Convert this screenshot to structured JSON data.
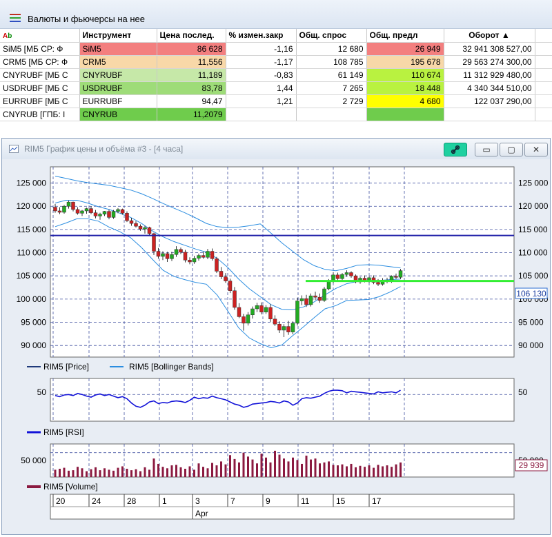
{
  "quotes_window": {
    "title": "Валюты и фьючерсы на нее",
    "ab_marker": {
      "a": "A",
      "b": "b"
    },
    "columns": [
      "Инструмент",
      "Цена послед.",
      "% измен.закр",
      "Общ. спрос",
      "Общ. предл",
      "Оборот ▲"
    ],
    "rows": [
      {
        "name": "SiM5 [МБ СР: Ф",
        "code": "SiM5",
        "price": "86 628",
        "change": "-1,16",
        "bid": "12 680",
        "offer": "26 949",
        "turnover": "32 941 308 527,00",
        "color": "#f37f7f",
        "offer_color": "#f37f7f"
      },
      {
        "name": "CRM5 [МБ СР: Ф",
        "code": "CRM5",
        "price": "11,556",
        "change": "-1,17",
        "bid": "108 785",
        "offer": "195 678",
        "turnover": "29 563 274 300,00",
        "color": "#f8d8a8",
        "offer_color": "#f8d8a8"
      },
      {
        "name": "CNYRUBF [МБ С",
        "code": "CNYRUBF",
        "price": "11,189",
        "change": "-0,83",
        "bid": "61 149",
        "offer": "110 674",
        "turnover": "11 312 929 480,00",
        "color": "#c6e8a8",
        "offer_color": "#b9f240"
      },
      {
        "name": "USDRUBF [МБ С",
        "code": "USDRUBF",
        "price": "83,78",
        "change": "1,44",
        "bid": "7 265",
        "offer": "18 448",
        "turnover": "4 340 344 510,00",
        "color": "#9edc78",
        "offer_color": "#b9f240"
      },
      {
        "name": "EURRUBF [МБ С",
        "code": "EURRUBF",
        "price": "94,47",
        "change": "1,21",
        "bid": "2 729",
        "offer": "4 680",
        "turnover": "122 037 290,00",
        "color": "#ffffff",
        "offer_color": "#ffff00"
      },
      {
        "name": "CNYRUB [ГПБ: I",
        "code": "CNYRUB",
        "price": "11,2079",
        "change": "",
        "bid": "",
        "offer": "",
        "turnover": "",
        "color": "#6fcc4c",
        "offer_color": "#6fcc4c"
      }
    ]
  },
  "chart_window": {
    "title": "RIM5 График цены и объёма #3 - [4 часа]",
    "buttons": {
      "link": "link-icon",
      "minimize": "▭",
      "restore": "▢",
      "close": "✕"
    },
    "price_axis_labels": [
      "125 000",
      "120 000",
      "115 000",
      "110 000",
      "105 000",
      "100 000",
      "95 000",
      "90 000"
    ],
    "current_price_label": "106 130",
    "rsi_axis_label": "50",
    "volume_axis_label": "50 000",
    "current_volume_label": "29 939",
    "legend_price": "RIM5 [Price]",
    "legend_bollinger": "RIM5 [Bollinger Bands]",
    "legend_rsi": "RIM5 [RSI]",
    "legend_volume": "RIM5 [Volume]",
    "date_labels": [
      "20",
      "24",
      "28",
      "1",
      "3",
      "7",
      "9",
      "11",
      "15",
      "17"
    ],
    "month_label": "Apr",
    "colors": {
      "up": "#22aa22",
      "down": "#cc2222",
      "bollinger": "#2b8de0",
      "level": "#1f1fa8",
      "green_level": "#33ee33",
      "rsi": "#1212d8",
      "volume": "#8b1a40"
    }
  },
  "chart_data": {
    "type": "candlestick",
    "price_ylim": [
      87500,
      128500
    ],
    "horizontal_levels": [
      113700,
      103900
    ],
    "candles": [
      [
        119800,
        120500,
        118600,
        119000
      ],
      [
        119000,
        119800,
        118300,
        118700
      ],
      [
        118700,
        120300,
        118400,
        120000
      ],
      [
        120000,
        121200,
        119500,
        120900
      ],
      [
        120900,
        121000,
        118900,
        119300
      ],
      [
        119300,
        119800,
        118200,
        118500
      ],
      [
        118500,
        119200,
        117900,
        119000
      ],
      [
        119000,
        119700,
        118400,
        119500
      ],
      [
        119500,
        120000,
        118300,
        118600
      ],
      [
        118600,
        119200,
        117400,
        117900
      ],
      [
        117900,
        118600,
        117100,
        118300
      ],
      [
        118300,
        119000,
        117900,
        118900
      ],
      [
        118900,
        119300,
        117200,
        117600
      ],
      [
        117600,
        119200,
        117300,
        118900
      ],
      [
        118900,
        119600,
        118500,
        119300
      ],
      [
        119300,
        119500,
        118200,
        118500
      ],
      [
        118500,
        118900,
        116600,
        116900
      ],
      [
        116900,
        117500,
        115800,
        116300
      ],
      [
        116300,
        116800,
        115400,
        115700
      ],
      [
        115700,
        116100,
        114700,
        115100
      ],
      [
        115100,
        115800,
        114100,
        115400
      ],
      [
        115400,
        115600,
        113700,
        114100
      ],
      [
        114100,
        114300,
        109500,
        110300
      ],
      [
        110300,
        111000,
        108700,
        109200
      ],
      [
        109200,
        110300,
        108400,
        109800
      ],
      [
        109800,
        110200,
        108000,
        108700
      ],
      [
        108700,
        110200,
        108200,
        109600
      ],
      [
        109600,
        111400,
        109100,
        110700
      ],
      [
        110700,
        111100,
        109700,
        110100
      ],
      [
        110100,
        110600,
        107900,
        108400
      ],
      [
        108400,
        109000,
        107500,
        108000
      ],
      [
        108000,
        109300,
        107600,
        108800
      ],
      [
        108800,
        109800,
        108300,
        109400
      ],
      [
        109400,
        110200,
        108700,
        109000
      ],
      [
        109000,
        110800,
        108600,
        110300
      ],
      [
        110300,
        110900,
        108300,
        108700
      ],
      [
        108700,
        109100,
        105600,
        106000
      ],
      [
        106000,
        106900,
        104300,
        104800
      ],
      [
        104800,
        105600,
        103500,
        103900
      ],
      [
        103900,
        104400,
        101300,
        101800
      ],
      [
        101800,
        102600,
        97700,
        98200
      ],
      [
        98200,
        99100,
        95900,
        96200
      ],
      [
        96200,
        96800,
        93200,
        94800
      ],
      [
        94800,
        97200,
        94300,
        96600
      ],
      [
        96600,
        98400,
        95800,
        97900
      ],
      [
        97900,
        99200,
        97200,
        98600
      ],
      [
        98600,
        99300,
        96700,
        97200
      ],
      [
        97200,
        98700,
        96800,
        98200
      ],
      [
        98200,
        98900,
        95100,
        95700
      ],
      [
        95700,
        96500,
        94200,
        94600
      ],
      [
        94600,
        95200,
        92700,
        93300
      ],
      [
        93300,
        94600,
        91800,
        94100
      ],
      [
        94100,
        95300,
        92300,
        92900
      ],
      [
        92900,
        95200,
        92400,
        94800
      ],
      [
        94800,
        100300,
        94300,
        99600
      ],
      [
        99600,
        100800,
        98700,
        100100
      ],
      [
        100100,
        100900,
        98300,
        98800
      ],
      [
        98800,
        101200,
        98400,
        100700
      ],
      [
        100700,
        101600,
        99800,
        100400
      ],
      [
        100400,
        101200,
        99200,
        99700
      ],
      [
        99700,
        102600,
        99400,
        102200
      ],
      [
        102200,
        104300,
        101900,
        103800
      ],
      [
        103800,
        105800,
        103400,
        105200
      ],
      [
        105200,
        105700,
        103900,
        104400
      ],
      [
        104400,
        105600,
        104100,
        105300
      ],
      [
        105300,
        106200,
        104800,
        105700
      ],
      [
        105700,
        106000,
        104600,
        105000
      ],
      [
        105000,
        105300,
        103400,
        103700
      ],
      [
        103700,
        104800,
        103300,
        104500
      ],
      [
        104500,
        105100,
        103600,
        104000
      ],
      [
        104000,
        104900,
        103500,
        104600
      ],
      [
        104600,
        105100,
        103200,
        103600
      ],
      [
        103600,
        104300,
        102800,
        103200
      ],
      [
        103200,
        104500,
        102900,
        104100
      ],
      [
        104100,
        104600,
        103400,
        103800
      ],
      [
        103800,
        105100,
        103500,
        104900
      ],
      [
        104900,
        105500,
        104300,
        104700
      ],
      [
        104700,
        106500,
        104300,
        106130
      ]
    ],
    "bollinger_upper": [
      126500,
      126000,
      125500,
      125100,
      124800,
      124500,
      124000,
      123500,
      122700,
      121700,
      120600,
      119600,
      118600,
      117500,
      116300,
      115600,
      115400,
      115500,
      115800,
      116200,
      114200,
      112100,
      110300,
      108500,
      107200,
      106400,
      106100,
      106600,
      107300,
      107400,
      107300,
      107000,
      106700
    ],
    "bollinger_middle": [
      120700,
      121300,
      121300,
      120700,
      119900,
      119300,
      118500,
      117600,
      116300,
      114700,
      113400,
      112400,
      111600,
      110800,
      110100,
      108800,
      106800,
      104300,
      102200,
      100500,
      98800,
      97800,
      97700,
      98300,
      99400,
      100900,
      102300,
      103300,
      103800,
      103800,
      104000,
      104200,
      104300
    ],
    "bollinger_lower": [
      115600,
      116400,
      117300,
      117300,
      116800,
      115500,
      114500,
      113200,
      111100,
      108600,
      106200,
      104900,
      104200,
      103600,
      103200,
      100900,
      97400,
      93800,
      91600,
      90400,
      89500,
      90100,
      92100,
      94000,
      96000,
      97900,
      98600,
      99700,
      99800,
      99900,
      100500,
      101500,
      102700
    ],
    "rsi_ylim": [
      0,
      80
    ],
    "rsi": [
      48,
      46,
      49,
      50,
      48,
      52,
      50,
      47,
      45,
      49,
      51,
      48,
      50,
      47,
      44,
      46,
      42,
      34,
      28,
      26,
      30,
      36,
      38,
      33,
      35,
      34,
      37,
      38,
      37,
      35,
      39,
      45,
      42,
      44,
      43,
      47,
      44,
      42,
      40,
      36,
      32,
      30,
      26,
      28,
      32,
      33,
      34,
      35,
      37,
      36,
      34,
      38,
      36,
      30,
      34,
      42,
      44,
      43,
      45,
      47,
      52,
      56,
      58,
      58,
      57,
      53,
      56,
      55,
      54,
      53,
      52,
      51,
      55,
      53,
      54,
      55,
      53,
      58
    ],
    "volume_ylim": [
      0,
      68000
    ],
    "volume": [
      15000,
      17000,
      19000,
      13000,
      14000,
      21000,
      18000,
      12000,
      16000,
      20000,
      14000,
      18000,
      15000,
      13000,
      19000,
      22000,
      17000,
      14000,
      16000,
      12000,
      20000,
      15000,
      38000,
      27000,
      21000,
      18000,
      24000,
      25000,
      20000,
      17000,
      22000,
      15000,
      28000,
      21000,
      18000,
      29000,
      24000,
      32000,
      26000,
      45000,
      37000,
      30000,
      50000,
      42000,
      36000,
      28000,
      48000,
      40000,
      30000,
      54000,
      46000,
      38000,
      32000,
      40000,
      35000,
      27000,
      44000,
      36000,
      38000,
      28000,
      30000,
      32000,
      25000,
      24000,
      26000,
      22000,
      27000,
      20000,
      23000,
      21000,
      24000,
      19000,
      25000,
      22000,
      24000,
      21000,
      26000,
      29939
    ]
  }
}
